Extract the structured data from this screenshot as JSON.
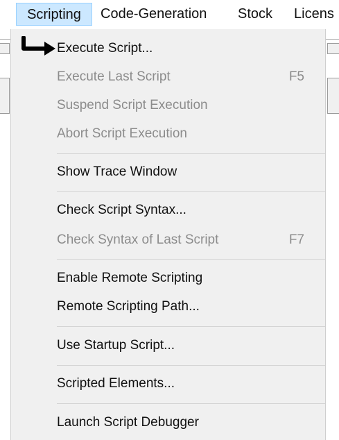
{
  "menubar": {
    "items": [
      {
        "label": "Scripting",
        "active": true
      },
      {
        "label": "Code-Generation"
      },
      {
        "label": "Stock"
      },
      {
        "label": "Licens"
      }
    ]
  },
  "dropdown": {
    "items": [
      {
        "label": "Execute Script...",
        "shortcut": "",
        "enabled": true
      },
      {
        "label": "Execute Last Script",
        "shortcut": "F5",
        "enabled": false
      },
      {
        "label": "Suspend Script Execution",
        "shortcut": "",
        "enabled": false
      },
      {
        "label": "Abort Script Execution",
        "shortcut": "",
        "enabled": false
      },
      {
        "label": "Show Trace Window",
        "shortcut": "",
        "enabled": true
      },
      {
        "label": "Check Script Syntax...",
        "shortcut": "",
        "enabled": true
      },
      {
        "label": "Check Syntax of Last Script",
        "shortcut": "F7",
        "enabled": false
      },
      {
        "label": "Enable Remote Scripting",
        "shortcut": "",
        "enabled": true
      },
      {
        "label": "Remote Scripting Path...",
        "shortcut": "",
        "enabled": true
      },
      {
        "label": "Use Startup Script...",
        "shortcut": "",
        "enabled": true
      },
      {
        "label": "Scripted Elements...",
        "shortcut": "",
        "enabled": true
      },
      {
        "label": "Launch Script Debugger",
        "shortcut": "",
        "enabled": true
      }
    ]
  },
  "annotation": {
    "icon": "pointing-arrow-icon",
    "color": "#000000"
  },
  "colors": {
    "menubar_highlight": "#cce8ff",
    "menu_background": "#f0f0f0",
    "disabled_text": "#8c8c8c"
  }
}
